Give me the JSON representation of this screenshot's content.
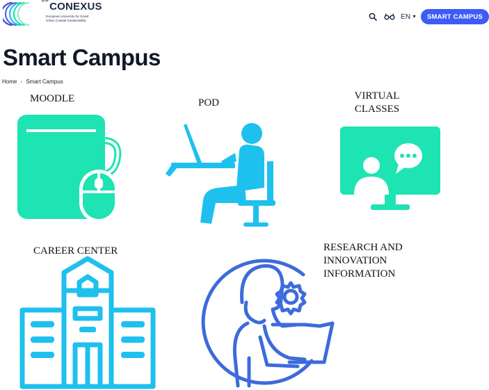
{
  "header": {
    "logo": {
      "name_prefix": "EU",
      "name": "CONEXUS",
      "tagline_line1": "European University for Smart",
      "tagline_line2": "Urban Coastal Sustainability"
    },
    "icons": {
      "search": "search-icon",
      "accessibility": "glasses-icon"
    },
    "language": "EN",
    "cta_label": "SMART CAMPUS",
    "cta_color": "#3d5cf5"
  },
  "page": {
    "title": "Smart Campus",
    "breadcrumb": [
      "Home",
      "Smart Campus"
    ]
  },
  "cards": {
    "moodle": {
      "label": "MOODLE",
      "icon": "book-mouse-icon",
      "color": "#1ee3b3"
    },
    "pod": {
      "label": "POD",
      "icon": "person-laptop-icon",
      "color": "#1ec0ee"
    },
    "virtual_classes": {
      "label_line1": "VIRTUAL",
      "label_line2": "CLASSES",
      "icon": "video-call-icon",
      "color": "#1ee3b3"
    },
    "career_center": {
      "label": "CAREER CENTER",
      "icon": "building-icon",
      "color": "#1ec0ee"
    },
    "research": {
      "label_line1": "RESEARCH AND",
      "label_line2": "INNOVATION",
      "label_line3": "INFORMATION",
      "icon": "researcher-gear-icon",
      "color": "#3d6bdc"
    }
  }
}
